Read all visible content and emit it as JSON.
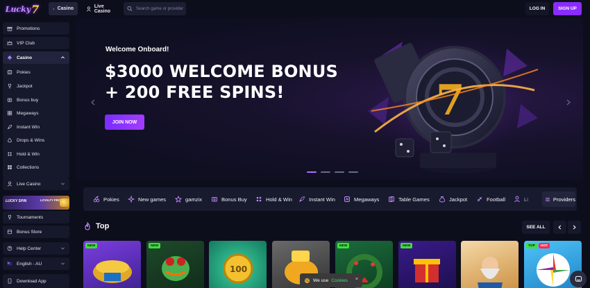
{
  "brand": {
    "logo_text": "Lucky",
    "logo_seven": "7"
  },
  "header": {
    "tabs": [
      {
        "label": "Casino"
      },
      {
        "label": "Live Casino"
      }
    ],
    "search_placeholder": "Search game or provider",
    "login_label": "LOG IN",
    "signup_label": "SIGN UP"
  },
  "sidebar": {
    "promotions": "Promotions",
    "vip_club": "VIP Club",
    "casino": "Casino",
    "casino_items": [
      "Pokies",
      "Jackpot",
      "Bonus buy",
      "Megaways",
      "Instant Win",
      "Drops & Wins",
      "Hold & Win",
      "Collections"
    ],
    "live_casino": "Live Casino",
    "lucky_spin": "LUCKY SPIN",
    "loyalty_program": "LOYALTY PROGRAM",
    "tournaments": "Tournaments",
    "bonus_store": "Bonus Store",
    "help_center": "Help Center",
    "language": "English - AU",
    "download_app": "Download App"
  },
  "hero": {
    "welcome": "Welcome Onboard!",
    "title_line1": "$3000 WELCOME BONUS",
    "title_line2": "+ 200 FREE SPINS!",
    "cta": "JOIN NOW",
    "slides": 4,
    "active_slide": 1
  },
  "categories": [
    "Pokies",
    "New games",
    "gamzix",
    "Bonus Buy",
    "Hold & Win",
    "Instant Win",
    "Megaways",
    "Table Games",
    "Jackpot",
    "Football",
    "Li"
  ],
  "providers_label": "Providers",
  "top_section": {
    "title": "Top",
    "see_all": "SEE ALL"
  },
  "games": [
    {
      "badges": [
        "NEW"
      ]
    },
    {
      "badges": [
        "NEW"
      ]
    },
    {
      "badges": []
    },
    {
      "badges": []
    },
    {
      "badges": [
        "NEW"
      ]
    },
    {
      "badges": [
        "NEW"
      ]
    },
    {
      "badges": []
    },
    {
      "badges": [
        "TOP",
        "HOT"
      ]
    }
  ],
  "cookie": {
    "text": "We use",
    "link": "Cookies",
    "close": "×"
  },
  "colors": {
    "accent": "#8a2bff",
    "background": "#0d0e1c",
    "panel": "#16182b"
  }
}
